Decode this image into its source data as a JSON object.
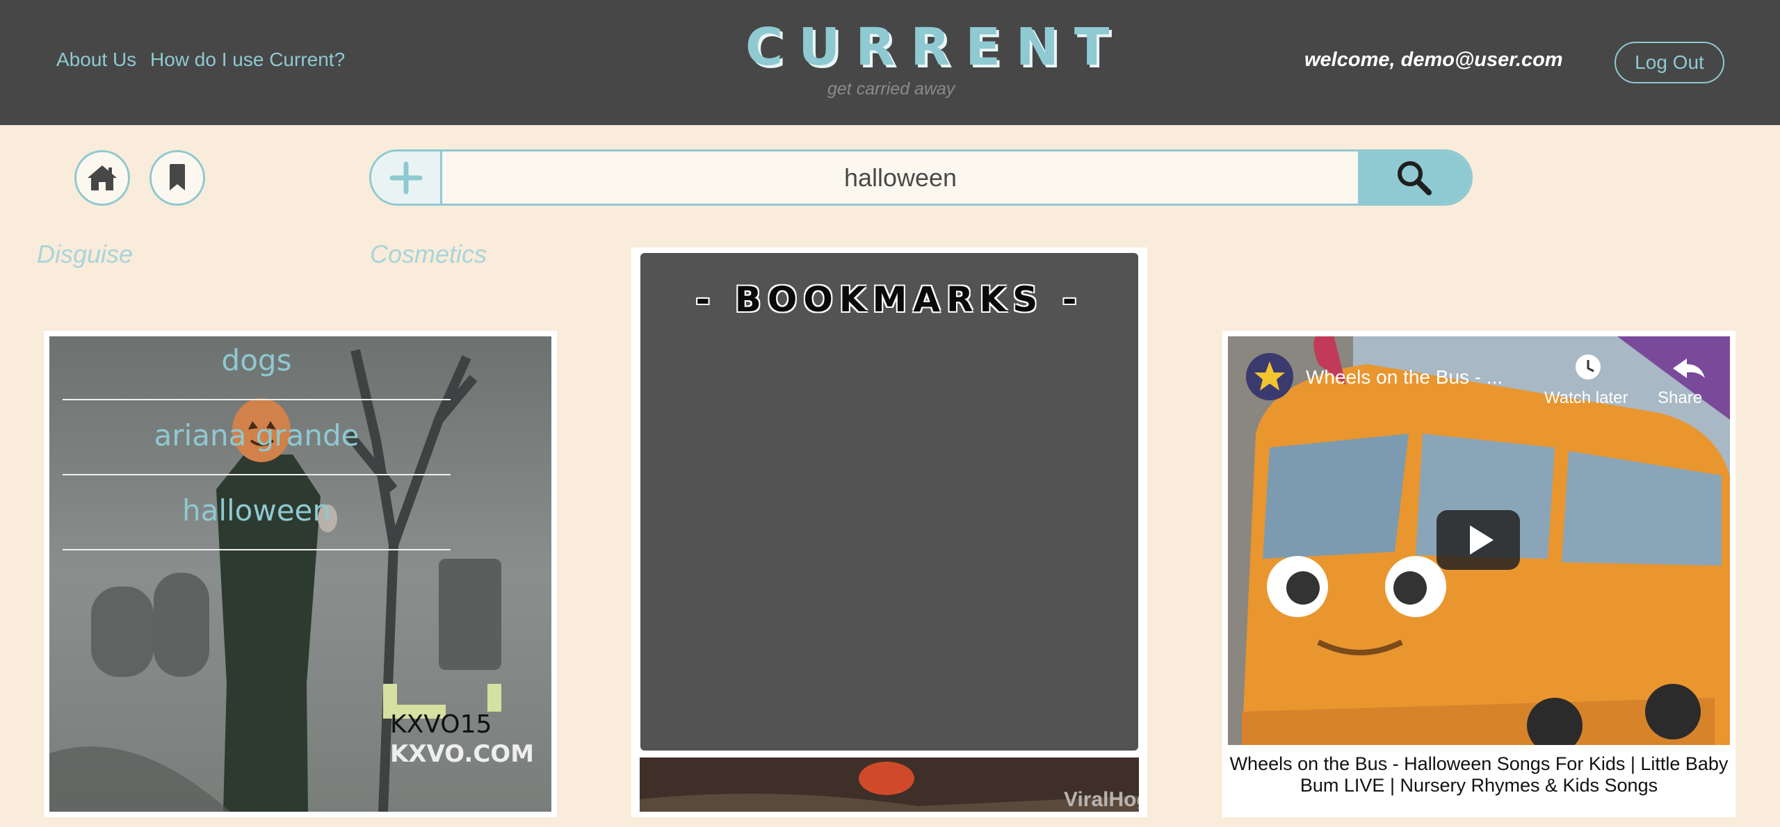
{
  "header": {
    "nav": {
      "about": "About Us",
      "howto": "How do I use Current?"
    },
    "logo": "CURRENT",
    "tagline": "get carried away",
    "welcome": "welcome, demo@user.com",
    "logout_label": "Log Out"
  },
  "toolbar": {
    "home_icon": "home-icon",
    "bookmark_icon": "bookmark-icon",
    "add_icon": "plus-icon",
    "search_icon": "search-icon"
  },
  "search": {
    "value": "halloween"
  },
  "categories": [
    "Disguise",
    "Cosmetics"
  ],
  "bookmarks": {
    "title": "- BOOKMARKS -",
    "items": [
      "dogs",
      "ariana grande",
      "halloween"
    ]
  },
  "cards": {
    "left": {
      "watermark_line1": "KXVO15",
      "watermark_line2": "KXVO.COM"
    },
    "center": {
      "watermark": "ViralHog"
    },
    "right": {
      "video_title": "Wheels on the Bus - ...",
      "watch_later": "Watch later",
      "share": "Share",
      "caption": "Wheels on the Bus - Halloween Songs For Kids | Little Baby Bum LIVE | Nursery Rhymes & Kids Songs"
    }
  },
  "colors": {
    "accent": "#8fc9d1",
    "header_bg": "#474747",
    "page_bg": "#f9ecdb",
    "panel_bg": "#535353"
  }
}
